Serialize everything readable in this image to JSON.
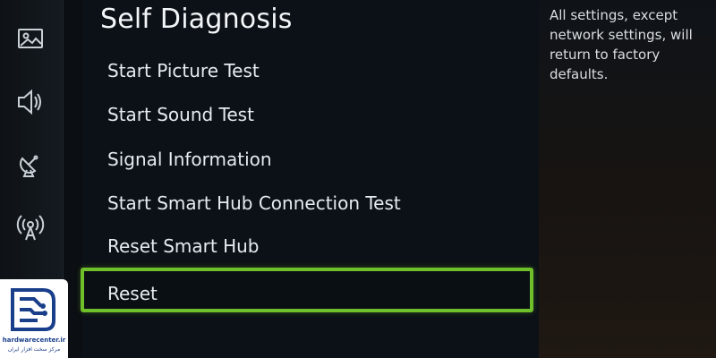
{
  "panel": {
    "title": "Self Diagnosis",
    "items": [
      {
        "label": "Start Picture Test"
      },
      {
        "label": "Start Sound Test"
      },
      {
        "label": "Signal Information"
      },
      {
        "label": "Start Smart Hub Connection Test"
      },
      {
        "label": "Reset Smart Hub"
      },
      {
        "label": "Reset",
        "selected": true
      }
    ]
  },
  "help": {
    "text": "All settings, except network settings, will return to factory defaults."
  },
  "rail": {
    "icons": [
      "picture-icon",
      "sound-icon",
      "broadcasting-icon",
      "network-icon",
      "support-icon"
    ]
  },
  "watermark": {
    "line1": "hardwarecenter.ir",
    "line2": "مرکز سخت افزار ایران"
  },
  "colors": {
    "selection_border": "#6fbf2a",
    "logo_blue": "#1a3f8a"
  }
}
